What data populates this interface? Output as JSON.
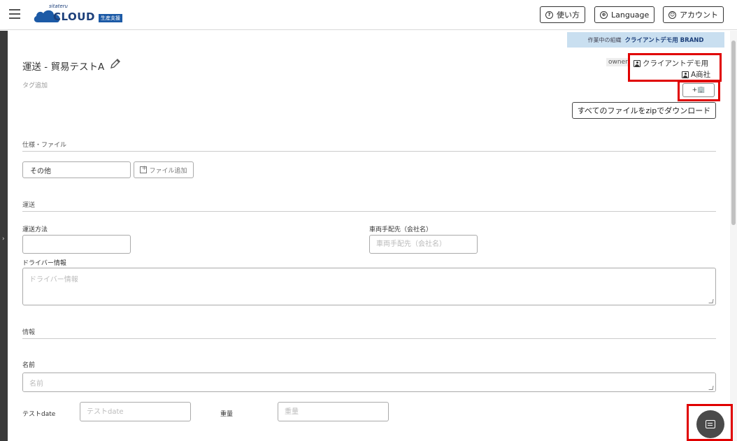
{
  "header": {
    "logo_small": "sitateru",
    "logo_main": "CLOUD",
    "logo_badge": "生産支援",
    "help_label": "使い方",
    "language_label": "Language",
    "account_label": "アカウント"
  },
  "org_banner": {
    "prefix": "作業中の組織",
    "name": "クライアントデモ用 BRAND"
  },
  "project": {
    "title": "運送 - 貿易テストA",
    "tag_add": "タグ追加",
    "owner_label": "owner",
    "client_name": "クライアントデモ用",
    "trading_company": "A商社",
    "add_company_label": "+🏢",
    "zip_download_label": "すべてのファイルをzipでダウンロード"
  },
  "spec_section": {
    "title": "仕様・ファイル",
    "category_value": "その他",
    "file_add_label": "ファイル追加"
  },
  "shipping_section": {
    "title": "運送",
    "method_label": "運送方法",
    "method_value": "",
    "vehicle_label": "車両手配先（会社名）",
    "vehicle_placeholder": "車両手配先（会社名）",
    "driver_label": "ドライバー情報",
    "driver_placeholder": "ドライバー情報"
  },
  "info_section": {
    "title": "情報",
    "name_label": "名前",
    "name_placeholder": "名前",
    "test_date_label": "テストdate",
    "test_date_placeholder": "テストdate",
    "weight_label": "重量",
    "weight_placeholder": "重量"
  },
  "colors": {
    "accent": "#1c3f7a",
    "banner": "#c9dff0",
    "highlight": "#e00000"
  }
}
